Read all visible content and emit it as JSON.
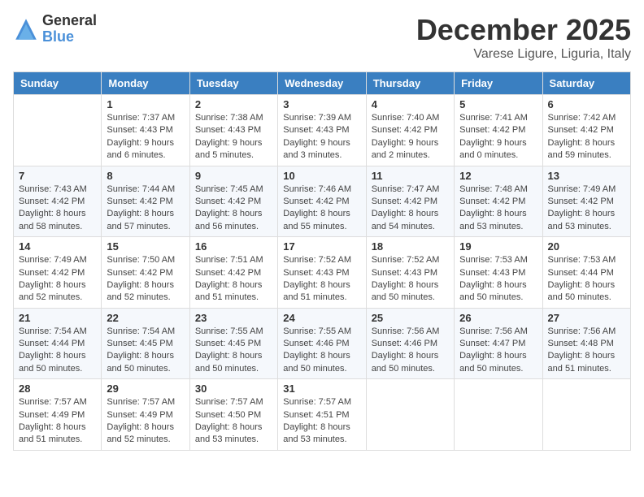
{
  "header": {
    "logo_general": "General",
    "logo_blue": "Blue",
    "month_title": "December 2025",
    "subtitle": "Varese Ligure, Liguria, Italy"
  },
  "days_of_week": [
    "Sunday",
    "Monday",
    "Tuesday",
    "Wednesday",
    "Thursday",
    "Friday",
    "Saturday"
  ],
  "weeks": [
    [
      {
        "day": "",
        "info": ""
      },
      {
        "day": "1",
        "info": "Sunrise: 7:37 AM\nSunset: 4:43 PM\nDaylight: 9 hours\nand 6 minutes."
      },
      {
        "day": "2",
        "info": "Sunrise: 7:38 AM\nSunset: 4:43 PM\nDaylight: 9 hours\nand 5 minutes."
      },
      {
        "day": "3",
        "info": "Sunrise: 7:39 AM\nSunset: 4:43 PM\nDaylight: 9 hours\nand 3 minutes."
      },
      {
        "day": "4",
        "info": "Sunrise: 7:40 AM\nSunset: 4:42 PM\nDaylight: 9 hours\nand 2 minutes."
      },
      {
        "day": "5",
        "info": "Sunrise: 7:41 AM\nSunset: 4:42 PM\nDaylight: 9 hours\nand 0 minutes."
      },
      {
        "day": "6",
        "info": "Sunrise: 7:42 AM\nSunset: 4:42 PM\nDaylight: 8 hours\nand 59 minutes."
      }
    ],
    [
      {
        "day": "7",
        "info": "Sunrise: 7:43 AM\nSunset: 4:42 PM\nDaylight: 8 hours\nand 58 minutes."
      },
      {
        "day": "8",
        "info": "Sunrise: 7:44 AM\nSunset: 4:42 PM\nDaylight: 8 hours\nand 57 minutes."
      },
      {
        "day": "9",
        "info": "Sunrise: 7:45 AM\nSunset: 4:42 PM\nDaylight: 8 hours\nand 56 minutes."
      },
      {
        "day": "10",
        "info": "Sunrise: 7:46 AM\nSunset: 4:42 PM\nDaylight: 8 hours\nand 55 minutes."
      },
      {
        "day": "11",
        "info": "Sunrise: 7:47 AM\nSunset: 4:42 PM\nDaylight: 8 hours\nand 54 minutes."
      },
      {
        "day": "12",
        "info": "Sunrise: 7:48 AM\nSunset: 4:42 PM\nDaylight: 8 hours\nand 53 minutes."
      },
      {
        "day": "13",
        "info": "Sunrise: 7:49 AM\nSunset: 4:42 PM\nDaylight: 8 hours\nand 53 minutes."
      }
    ],
    [
      {
        "day": "14",
        "info": "Sunrise: 7:49 AM\nSunset: 4:42 PM\nDaylight: 8 hours\nand 52 minutes."
      },
      {
        "day": "15",
        "info": "Sunrise: 7:50 AM\nSunset: 4:42 PM\nDaylight: 8 hours\nand 52 minutes."
      },
      {
        "day": "16",
        "info": "Sunrise: 7:51 AM\nSunset: 4:42 PM\nDaylight: 8 hours\nand 51 minutes."
      },
      {
        "day": "17",
        "info": "Sunrise: 7:52 AM\nSunset: 4:43 PM\nDaylight: 8 hours\nand 51 minutes."
      },
      {
        "day": "18",
        "info": "Sunrise: 7:52 AM\nSunset: 4:43 PM\nDaylight: 8 hours\nand 50 minutes."
      },
      {
        "day": "19",
        "info": "Sunrise: 7:53 AM\nSunset: 4:43 PM\nDaylight: 8 hours\nand 50 minutes."
      },
      {
        "day": "20",
        "info": "Sunrise: 7:53 AM\nSunset: 4:44 PM\nDaylight: 8 hours\nand 50 minutes."
      }
    ],
    [
      {
        "day": "21",
        "info": "Sunrise: 7:54 AM\nSunset: 4:44 PM\nDaylight: 8 hours\nand 50 minutes."
      },
      {
        "day": "22",
        "info": "Sunrise: 7:54 AM\nSunset: 4:45 PM\nDaylight: 8 hours\nand 50 minutes."
      },
      {
        "day": "23",
        "info": "Sunrise: 7:55 AM\nSunset: 4:45 PM\nDaylight: 8 hours\nand 50 minutes."
      },
      {
        "day": "24",
        "info": "Sunrise: 7:55 AM\nSunset: 4:46 PM\nDaylight: 8 hours\nand 50 minutes."
      },
      {
        "day": "25",
        "info": "Sunrise: 7:56 AM\nSunset: 4:46 PM\nDaylight: 8 hours\nand 50 minutes."
      },
      {
        "day": "26",
        "info": "Sunrise: 7:56 AM\nSunset: 4:47 PM\nDaylight: 8 hours\nand 50 minutes."
      },
      {
        "day": "27",
        "info": "Sunrise: 7:56 AM\nSunset: 4:48 PM\nDaylight: 8 hours\nand 51 minutes."
      }
    ],
    [
      {
        "day": "28",
        "info": "Sunrise: 7:57 AM\nSunset: 4:49 PM\nDaylight: 8 hours\nand 51 minutes."
      },
      {
        "day": "29",
        "info": "Sunrise: 7:57 AM\nSunset: 4:49 PM\nDaylight: 8 hours\nand 52 minutes."
      },
      {
        "day": "30",
        "info": "Sunrise: 7:57 AM\nSunset: 4:50 PM\nDaylight: 8 hours\nand 53 minutes."
      },
      {
        "day": "31",
        "info": "Sunrise: 7:57 AM\nSunset: 4:51 PM\nDaylight: 8 hours\nand 53 minutes."
      },
      {
        "day": "",
        "info": ""
      },
      {
        "day": "",
        "info": ""
      },
      {
        "day": "",
        "info": ""
      }
    ]
  ]
}
